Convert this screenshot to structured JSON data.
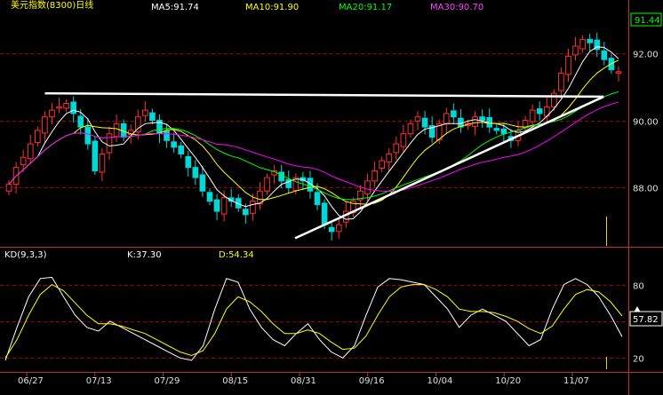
{
  "header": {
    "title": "美元指数(8300)日线",
    "ma5": "MA5:91.74",
    "ma10": "MA10:91.90",
    "ma20": "MA20:91.17",
    "ma30": "MA30:90.70"
  },
  "kd_header": {
    "label": "KD(9,3,3)",
    "k": "K:37.30",
    "d": "D:54.34"
  },
  "price_axis": {
    "current_price": "91.44",
    "ticks": [
      "92.00",
      "90.00",
      "88.00"
    ]
  },
  "kd_axis": {
    "ticks": [
      "80",
      "20"
    ],
    "cursor_value": "57.82"
  },
  "date_labels": [
    "06/27",
    "07/13",
    "07/29",
    "08/15",
    "08/31",
    "09/16",
    "10/04",
    "10/20",
    "11/07"
  ],
  "colors": {
    "background": "#000000",
    "up_candle": "#ff3030",
    "down_candle": "#00d8d8",
    "ma5": "#ffffff",
    "ma10": "#ffff00",
    "ma20": "#00ff00",
    "ma30": "#ff00ff",
    "k_line": "#ffffff",
    "d_line": "#ffff00",
    "grid": "#a00000",
    "trendline": "#ffffff"
  },
  "chart_data": {
    "type": "candlestick",
    "ylim": [
      86.3,
      93.2
    ],
    "x": [
      "06/27",
      "07/13",
      "07/29",
      "08/15",
      "08/31",
      "09/16",
      "10/04",
      "10/20",
      "11/07"
    ],
    "close": [
      88.1,
      88.6,
      88.9,
      89.3,
      89.7,
      90.1,
      90.3,
      90.4,
      90.5,
      90.2,
      89.8,
      89.3,
      88.5,
      89.0,
      89.6,
      89.9,
      89.5,
      89.7,
      90.1,
      90.3,
      90.0,
      89.6,
      89.4,
      89.2,
      89.0,
      88.6,
      88.3,
      87.9,
      87.6,
      87.3,
      87.7,
      87.6,
      87.4,
      87.2,
      87.6,
      87.9,
      88.3,
      88.5,
      88.2,
      88.0,
      88.3,
      88.2,
      87.9,
      87.5,
      86.9,
      86.7,
      86.9,
      87.3,
      87.6,
      87.9,
      88.2,
      88.5,
      88.8,
      89.0,
      89.3,
      89.6,
      89.9,
      90.1,
      89.8,
      89.5,
      89.9,
      90.2,
      90.1,
      89.8,
      89.9,
      90.1,
      90.0,
      89.8,
      89.7,
      89.6,
      89.4,
      89.7,
      90.0,
      90.3,
      90.2,
      90.4,
      90.8,
      91.4,
      91.9,
      92.2,
      92.4,
      92.3,
      92.1,
      91.8,
      91.5,
      91.44
    ],
    "ma": [
      {
        "name": "MA5",
        "period": 5,
        "value": 91.74
      },
      {
        "name": "MA10",
        "period": 10,
        "value": 91.9
      },
      {
        "name": "MA20",
        "period": 20,
        "value": 91.17
      },
      {
        "name": "MA30",
        "period": 30,
        "value": 90.7
      }
    ],
    "kd": {
      "name": "KD(9,3,3)",
      "K": 37.3,
      "D": 54.34,
      "ylim": [
        10,
        95
      ],
      "K_series": [
        18,
        45,
        70,
        85,
        86,
        70,
        55,
        45,
        42,
        50,
        45,
        40,
        35,
        30,
        25,
        20,
        18,
        30,
        60,
        85,
        82,
        60,
        45,
        35,
        30,
        40,
        48,
        35,
        25,
        20,
        30,
        55,
        78,
        85,
        84,
        82,
        80,
        70,
        60,
        45,
        55,
        60,
        55,
        50,
        40,
        30,
        35,
        60,
        80,
        85,
        80,
        70,
        55,
        37.3
      ],
      "D_series": [
        20,
        35,
        55,
        72,
        80,
        75,
        65,
        55,
        48,
        48,
        46,
        43,
        40,
        35,
        30,
        25,
        22,
        26,
        40,
        60,
        70,
        66,
        58,
        48,
        40,
        40,
        43,
        40,
        33,
        27,
        28,
        38,
        55,
        70,
        78,
        80,
        80,
        76,
        70,
        60,
        58,
        58,
        57,
        54,
        50,
        44,
        40,
        46,
        60,
        72,
        76,
        74,
        66,
        54.34
      ]
    },
    "trendlines": [
      {
        "name": "resistance",
        "from": [
          "07/03",
          90.8
        ],
        "to": [
          "11/15",
          90.7
        ]
      },
      {
        "name": "support",
        "from": [
          "09/02",
          86.5
        ],
        "to": [
          "11/15",
          90.7
        ]
      }
    ]
  }
}
